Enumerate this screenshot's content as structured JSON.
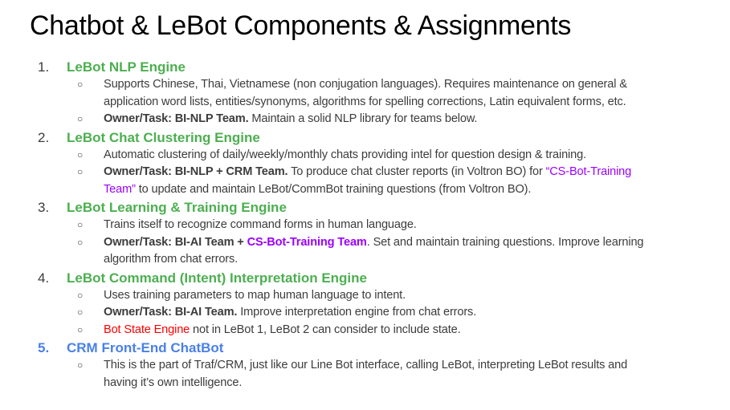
{
  "title": "Chatbot & LeBot Components & Assignments",
  "colors": {
    "green": "#4caf50",
    "blue": "#4a80e8",
    "purple": "#9b00ff",
    "red": "#ff0000",
    "text": "#3c3c3c"
  },
  "bullet_glyph": "○",
  "items": [
    {
      "number": "1.",
      "color": "green",
      "heading": "LeBot NLP Engine",
      "bullets": [
        [
          [
            {
              "t": "Supports Chinese, Thai, Vietnamese (non conjugation languages). Requires maintenance on general &"
            }
          ],
          [
            {
              "t": "application word lists, entities/synonyms, algorithms for spelling corrections, Latin equivalent forms, etc."
            }
          ]
        ],
        [
          [
            {
              "t": "Owner/Task: BI-NLP Team.",
              "s": "b"
            },
            {
              "t": " Maintain a solid NLP library for teams below."
            }
          ]
        ]
      ]
    },
    {
      "number": "2.",
      "color": "green",
      "heading": "LeBot Chat Clustering Engine",
      "bullets": [
        [
          [
            {
              "t": "Automatic clustering of daily/weekly/monthly chats providing intel for question design & training."
            }
          ]
        ],
        [
          [
            {
              "t": "Owner/Task: BI-NLP + CRM Team.",
              "s": "b"
            },
            {
              "t": " To produce chat cluster reports (in Voltron BO) for "
            },
            {
              "t": "“CS-Bot-Training",
              "s": "purple"
            }
          ],
          [
            {
              "t": "Team”",
              "s": "purple"
            },
            {
              "t": " to update and maintain LeBot/CommBot training questions (from Voltron BO)."
            }
          ]
        ]
      ]
    },
    {
      "number": "3.",
      "color": "green",
      "heading": "LeBot Learning & Training Engine",
      "bullets": [
        [
          [
            {
              "t": "Trains itself to recognize command forms in human language."
            }
          ]
        ],
        [
          [
            {
              "t": "Owner/Task: BI-AI Team + ",
              "s": "b"
            },
            {
              "t": "CS-Bot-Training Team",
              "s": "b purple"
            },
            {
              "t": ". Set and maintain training questions. Improve learning"
            }
          ],
          [
            {
              "t": "algorithm from chat errors."
            }
          ]
        ]
      ]
    },
    {
      "number": "4.",
      "color": "green",
      "heading": "LeBot Command (Intent) Interpretation Engine",
      "bullets": [
        [
          [
            {
              "t": "Uses training parameters to map human language to intent."
            }
          ]
        ],
        [
          [
            {
              "t": "Owner/Task: BI-AI Team.",
              "s": "b"
            },
            {
              "t": " Improve interpretation engine from chat errors."
            }
          ]
        ],
        [
          [
            {
              "t": "Bot State Engine",
              "s": "red"
            },
            {
              "t": " not in LeBot 1, LeBot 2 can consider to include state."
            }
          ]
        ]
      ]
    },
    {
      "number": "5.",
      "color": "blue",
      "heading": "CRM Front-End ChatBot",
      "bullets": [
        [
          [
            {
              "t": "This is the part of Traf/CRM, just like our Line Bot interface, calling LeBot, interpreting LeBot results and"
            }
          ],
          [
            {
              "t": "having it’s own intelligence."
            }
          ]
        ]
      ]
    }
  ]
}
